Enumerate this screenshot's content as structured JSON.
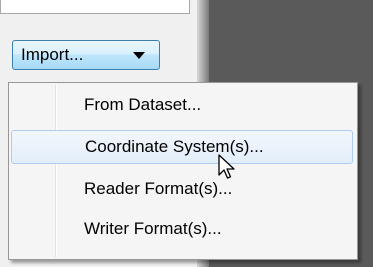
{
  "import_button": {
    "label": "Import...",
    "arrow_icon": "caret-down-icon"
  },
  "menu": {
    "items": [
      {
        "label": "From Dataset..."
      },
      {
        "label": "Coordinate System(s)...",
        "hovered": true
      },
      {
        "label": "Reader Format(s)..."
      },
      {
        "label": "Writer Format(s)..."
      }
    ]
  },
  "colors": {
    "button_border": "#3c7fb1",
    "hover_border": "#aeccef",
    "menu_background": "#f5f5f5"
  }
}
